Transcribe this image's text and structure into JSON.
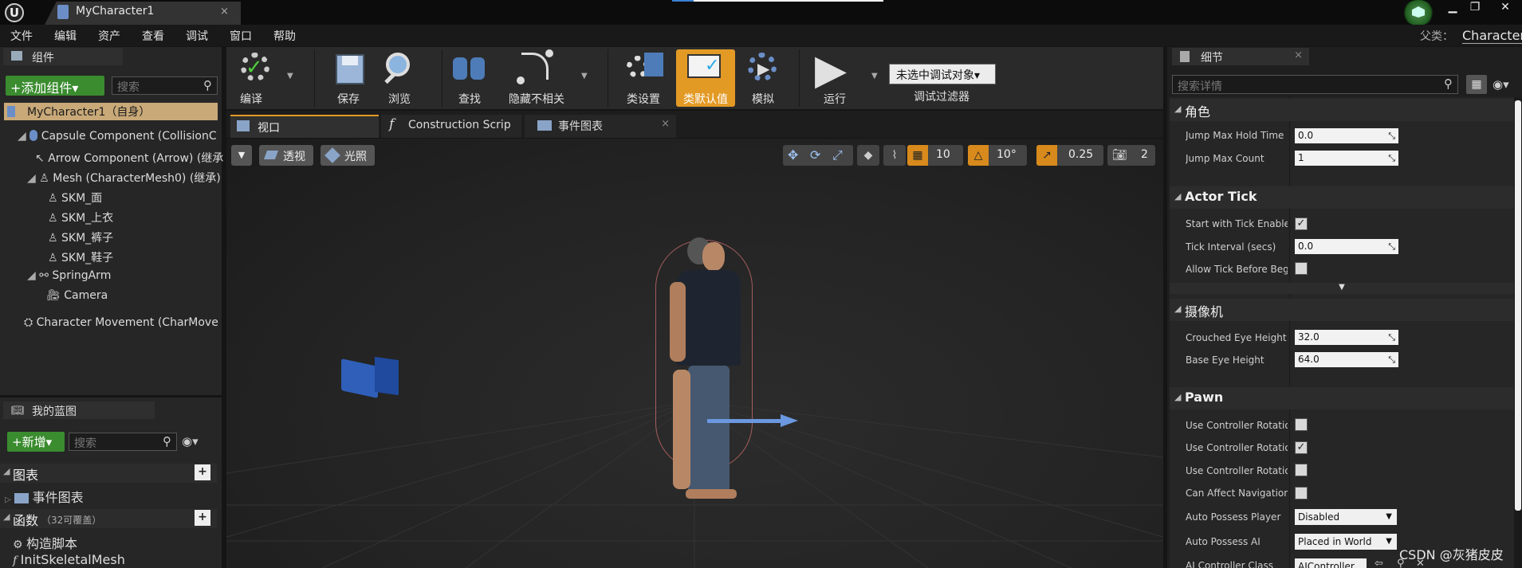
{
  "window": {
    "tab_title": "MyCharacter1",
    "parent_label": "父类：",
    "parent_value": "Character"
  },
  "menu": [
    "文件",
    "编辑",
    "资产",
    "查看",
    "调试",
    "窗口",
    "帮助"
  ],
  "components": {
    "tab": "组件",
    "add_button": "+添加组件▾",
    "search_placeholder": "搜索",
    "self_row": "MyCharacter1（自身）",
    "tree": [
      "Capsule Component (CollisionC",
      "Arrow Component (Arrow) (继承",
      "Mesh (CharacterMesh0) (继承)",
      "SKM_面",
      "SKM_上衣",
      "SKM_裤子",
      "SKM_鞋子",
      "SpringArm",
      "Camera",
      "Character Movement (CharMove"
    ]
  },
  "my_blueprint": {
    "tab": "我的蓝图",
    "new_button": "+新增▾",
    "search_placeholder": "搜索",
    "graphs_header": "图表",
    "event_graph": "事件图表",
    "functions_header": "函数",
    "functions_count": "（32可覆盖）",
    "functions": [
      "构造脚本",
      "InitSkeletalMesh"
    ]
  },
  "toolbar": {
    "compile": "编译",
    "save": "保存",
    "browse": "浏览",
    "find": "查找",
    "hide_unrelated": "隐藏不相关",
    "class_settings": "类设置",
    "class_defaults": "类默认值",
    "simulate": "模拟",
    "play": "运行",
    "debug_object": "未选中调试对象▾",
    "debug_filter": "调试过滤器"
  },
  "editor_tabs": [
    "视口",
    "Construction Scrip",
    "事件图表"
  ],
  "viewport": {
    "perspective": "透视",
    "lit": "光照",
    "grid_snap": "10",
    "rotation_snap": "10°",
    "scale_snap": "0.25",
    "camera_speed": "2"
  },
  "details": {
    "tab": "细节",
    "search_placeholder": "搜索详情",
    "categories": {
      "character": "角色",
      "actor_tick": "Actor Tick",
      "camera": "摄像机",
      "pawn": "Pawn"
    },
    "props": {
      "jump_max_hold_time": {
        "label": "Jump Max Hold Time",
        "value": "0.0"
      },
      "jump_max_count": {
        "label": "Jump Max Count",
        "value": "1"
      },
      "start_with_tick": {
        "label": "Start with Tick Enabled",
        "checked": true
      },
      "tick_interval": {
        "label": "Tick Interval (secs)",
        "value": "0.0"
      },
      "allow_tick_before": {
        "label": "Allow Tick Before Begi",
        "checked": false
      },
      "crouched_eye_height": {
        "label": "Crouched Eye Height",
        "value": "32.0"
      },
      "base_eye_height": {
        "label": "Base Eye Height",
        "value": "64.0"
      },
      "use_ctrl_rot_1": {
        "label": "Use Controller Rotation",
        "checked": false
      },
      "use_ctrl_rot_2": {
        "label": "Use Controller Rotation",
        "checked": true
      },
      "use_ctrl_rot_3": {
        "label": "Use Controller Rotation",
        "checked": false
      },
      "can_affect_nav": {
        "label": "Can Affect Navigation G",
        "checked": false
      },
      "auto_possess_player": {
        "label": "Auto Possess Player",
        "value": "Disabled"
      },
      "auto_possess_ai": {
        "label": "Auto Possess AI",
        "value": "Placed in World"
      },
      "ai_controller_class": {
        "label": "AI Controller Class",
        "value": "AIController"
      }
    }
  },
  "watermark": "CSDN @灰猪皮皮"
}
